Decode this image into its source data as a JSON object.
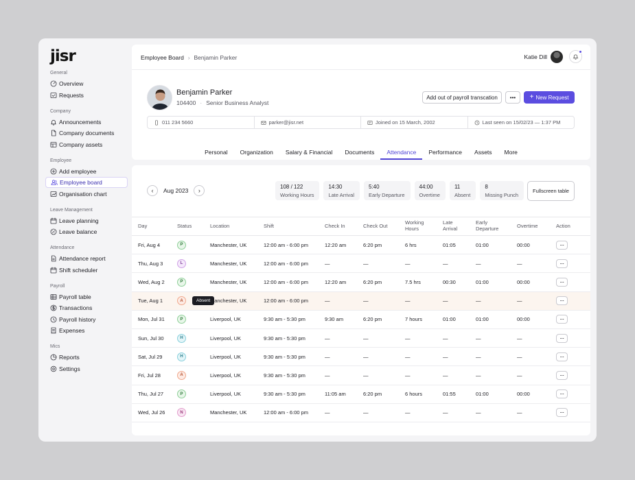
{
  "brand": "jisr",
  "nav": [
    {
      "title": "General",
      "items": [
        {
          "label": "Overview",
          "icon": "dashboard-icon"
        },
        {
          "label": "Requests",
          "icon": "requests-icon"
        }
      ]
    },
    {
      "title": "Company",
      "items": [
        {
          "label": "Announcements",
          "icon": "bell-icon"
        },
        {
          "label": "Company documents",
          "icon": "document-icon"
        },
        {
          "label": "Company assets",
          "icon": "assets-icon"
        }
      ]
    },
    {
      "title": "Employee",
      "items": [
        {
          "label": "Add employee",
          "icon": "add-icon"
        },
        {
          "label": "Employee board",
          "icon": "users-icon",
          "active": true
        },
        {
          "label": "Organisation chart",
          "icon": "chart-icon"
        }
      ]
    },
    {
      "title": "Leave Management",
      "items": [
        {
          "label": "Leave planning",
          "icon": "calendar-icon"
        },
        {
          "label": "Leave balance",
          "icon": "balance-icon"
        }
      ]
    },
    {
      "title": "Attendance",
      "items": [
        {
          "label": "Attendance report",
          "icon": "report-icon"
        },
        {
          "label": "Shift scheduler",
          "icon": "calendar-icon"
        }
      ]
    },
    {
      "title": "Payroll",
      "items": [
        {
          "label": "Payroll table",
          "icon": "table-icon"
        },
        {
          "label": "Transactions",
          "icon": "dollar-icon"
        },
        {
          "label": "Payroll history",
          "icon": "history-icon"
        },
        {
          "label": "Expenses",
          "icon": "receipt-icon"
        }
      ]
    },
    {
      "title": "Mics",
      "items": [
        {
          "label": "Reports",
          "icon": "pie-icon"
        },
        {
          "label": "Settings",
          "icon": "settings-icon"
        }
      ]
    }
  ],
  "header": {
    "breadcrumb": [
      "Employee Board",
      "Benjamin Parker"
    ],
    "user_name": "Katie Dill"
  },
  "profile": {
    "name": "Benjamin Parker",
    "id": "104400",
    "role": "Senior Business Analyst",
    "phone": "011 234 5660",
    "email": "parker@jisr.net",
    "joined": "Joined on 15 March, 2002",
    "last_seen": "Last seen on 15/02/23 — 1:37 PM"
  },
  "actions": {
    "payroll_label": "Add out of payroll transcation",
    "more_label": "•••",
    "new_request_label": "New Request"
  },
  "tabs": [
    "Personal",
    "Organization",
    "Salary & Financial",
    "Documents",
    "Attendance",
    "Performance",
    "Assets",
    "More"
  ],
  "active_tab": "Attendance",
  "attendance": {
    "month": "Aug 2023",
    "stats": [
      {
        "value": "108 / 122",
        "label": "Working Hours"
      },
      {
        "value": "14:30",
        "label": "Late Arrival"
      },
      {
        "value": "5:40",
        "label": "Early Departure"
      },
      {
        "value": "44:00",
        "label": "Overtime"
      },
      {
        "value": "11",
        "label": "Absent"
      },
      {
        "value": "8",
        "label": "Missing Punch"
      }
    ],
    "fullscreen_label": "Fullscreen table",
    "columns": [
      "Day",
      "Status",
      "Location",
      "Shift",
      "Check In",
      "Check Out",
      "Working\nHours",
      "Late\nArrival",
      "Early\nDeparture",
      "Overtime",
      "Action"
    ],
    "tooltip": "Absent",
    "rows": [
      {
        "day": "Fri, Aug 4",
        "status": "P",
        "location": "Manchester, UK",
        "shift": "12:00 am - 6:00 pm",
        "check_in": "12:20 am",
        "check_out": "6:20 pm",
        "hours": "6 hrs",
        "late": "01:05",
        "early": "01:00",
        "overtime": "00:00"
      },
      {
        "day": "Thu, Aug 3",
        "status": "L",
        "location": "Manchester, UK",
        "shift": "12:00 am - 6:00 pm",
        "check_in": "—",
        "check_out": "—",
        "hours": "—",
        "late": "—",
        "early": "—",
        "overtime": "—"
      },
      {
        "day": "Wed, Aug 2",
        "status": "P",
        "location": "Manchester, UK",
        "shift": "12:00 am - 6:00 pm",
        "check_in": "12:20 am",
        "check_out": "6:20 pm",
        "hours": "7.5 hrs",
        "late": "00:30",
        "early": "01:00",
        "overtime": "00:00"
      },
      {
        "day": "Tue, Aug 1",
        "status": "A",
        "location": "Manchester, UK",
        "shift": "12:00 am - 6:00 pm",
        "check_in": "—",
        "check_out": "—",
        "hours": "—",
        "late": "—",
        "early": "—",
        "overtime": "—",
        "highlight": true
      },
      {
        "day": "Mon, Jul 31",
        "status": "P",
        "location": "Liverpool, UK",
        "shift": "9:30 am - 5:30 pm",
        "check_in": "9:30 am",
        "check_out": "6:20 pm",
        "hours": "7 hours",
        "late": "01:00",
        "early": "01:00",
        "overtime": "00:00"
      },
      {
        "day": "Sun, Jul 30",
        "status": "H",
        "location": "Liverpool, UK",
        "shift": "9:30 am - 5:30 pm",
        "check_in": "—",
        "check_out": "—",
        "hours": "—",
        "late": "—",
        "early": "—",
        "overtime": "—"
      },
      {
        "day": "Sat, Jul 29",
        "status": "H",
        "location": "Liverpool, UK",
        "shift": "9:30 am - 5:30 pm",
        "check_in": "—",
        "check_out": "—",
        "hours": "—",
        "late": "—",
        "early": "—",
        "overtime": "—"
      },
      {
        "day": "Fri, Jul 28",
        "status": "A",
        "location": "Liverpool, UK",
        "shift": "9:30 am - 5:30 pm",
        "check_in": "—",
        "check_out": "—",
        "hours": "—",
        "late": "—",
        "early": "—",
        "overtime": "—"
      },
      {
        "day": "Thu, Jul 27",
        "status": "P",
        "location": "Liverpool, UK",
        "shift": "9:30 am - 5:30 pm",
        "check_in": "11:05 am",
        "check_out": "6:20 pm",
        "hours": "6 hours",
        "late": "01:55",
        "early": "01:00",
        "overtime": "00:00"
      },
      {
        "day": "Wed, Jul 26",
        "status": "N",
        "location": "Manchester, UK",
        "shift": "12:00 am - 6:00 pm",
        "check_in": "—",
        "check_out": "—",
        "hours": "—",
        "late": "—",
        "early": "—",
        "overtime": "—"
      }
    ]
  },
  "colors": {
    "accent": "#5b4de0",
    "highlight_row": "#fcf5ef"
  }
}
